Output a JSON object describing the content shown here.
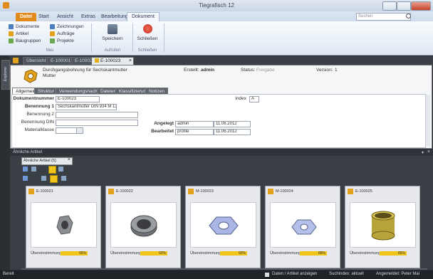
{
  "window": {
    "title": "Tiegrafisch 12"
  },
  "ribbon": {
    "tabs": [
      {
        "label": "Datei",
        "kind": "file"
      },
      {
        "label": "Start"
      },
      {
        "label": "Ansicht"
      },
      {
        "label": "Extras"
      },
      {
        "label": "Bearbeitung"
      },
      {
        "label": "Dokument",
        "kind": "active"
      }
    ],
    "search_placeholder": "Suchen",
    "group1_items": [
      {
        "label": "Dokumente",
        "color": "#4d7fbf"
      },
      {
        "label": "Artikel",
        "color": "#e4a11b"
      },
      {
        "label": "Baugruppen",
        "color": "#6aa84f"
      },
      {
        "label": "Zeichnungen",
        "color": "#4d7fbf"
      },
      {
        "label": "Aufträge",
        "color": "#e4a11b"
      },
      {
        "label": "Projekte",
        "color": "#6aa84f"
      }
    ],
    "group1_label": "Neu",
    "group2_button": "Speichern",
    "group2_label": "Aufrufen",
    "group3_button": "Schließen",
    "group3_label": "Schließen"
  },
  "doc_tabs": [
    "Übersicht",
    "E-100001",
    "E-100022",
    "E-100023"
  ],
  "side_tab": "Explorer",
  "header": {
    "line1": "Durchgangsbohrung für Sechskantmutter",
    "line2": "Mutter",
    "ersteller_label": "Erstellt:",
    "ersteller_value": "admin",
    "status_label": "Status:",
    "status_value": "Freigabe",
    "version_label": "Version:",
    "version_value": "1"
  },
  "sub_tabs": [
    "Allgemein",
    "Struktur",
    "Verwendungsnachweis",
    "Dateien",
    "Klassifizierung",
    "Notizen"
  ],
  "form": {
    "fields": [
      {
        "label": "Dokumentnummer",
        "value": "E-100023",
        "bold": true
      },
      {
        "label": "Benennung 1",
        "value": "Sechskantmutter DIN 934 M 12",
        "bold": true
      },
      {
        "label": "Benennung 2",
        "value": "",
        "bold": false
      },
      {
        "label": "Benennung DIN",
        "value": "",
        "bold": false
      },
      {
        "label": "Materialklasse",
        "value": "",
        "bold": false
      }
    ],
    "right_label": "Index",
    "right_value": "A",
    "created_label": "Angelegt",
    "created_user": "admin",
    "created_date": "11.06.2012",
    "edited_label": "Bearbeitet",
    "edited_user": "profile",
    "edited_date": "11.06.2012"
  },
  "lower_panel": {
    "title": "Ähnliche Artikel",
    "tab": "Ähnliche Artikel (5)",
    "cards": [
      {
        "title": "E-100021",
        "label": "Übereinstimmung",
        "value": "95%",
        "shape": "nut-small"
      },
      {
        "title": "E-100022",
        "label": "Übereinstimmung",
        "value": "92%",
        "shape": "ring"
      },
      {
        "title": "M-100023",
        "label": "Übereinstimmung",
        "value": "90%",
        "shape": "hex"
      },
      {
        "title": "M-100024",
        "label": "Übereinstimmung",
        "value": "88%",
        "shape": "hex-small"
      },
      {
        "title": "E-100025",
        "label": "Übereinstimmung",
        "value": "85%",
        "shape": "cylinder"
      }
    ]
  },
  "status": {
    "left": "Bereit",
    "mid": "Daten / Artikel anzeigen",
    "right1": "Suchindex: aktuell",
    "right2": "Angemeldet: Peter Mai"
  }
}
